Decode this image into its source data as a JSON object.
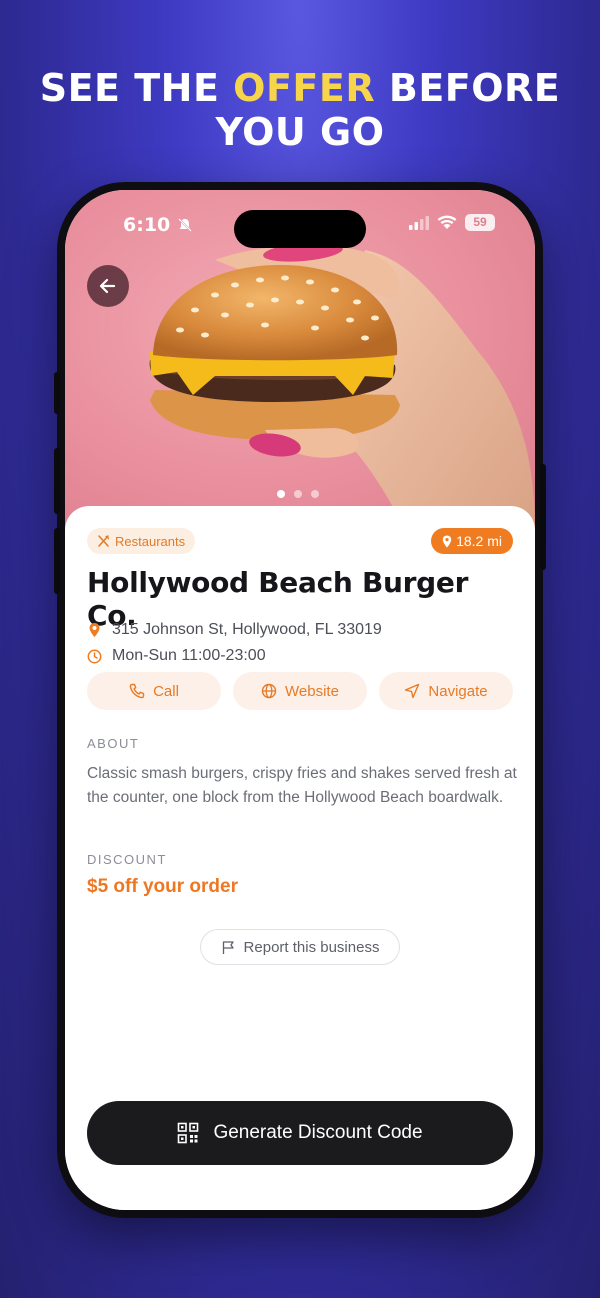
{
  "headline": {
    "part1": "SEE THE ",
    "highlight": "OFFER",
    "part2": " BEFORE",
    "line2": "YOU GO"
  },
  "status_bar": {
    "time": "6:10",
    "battery": "59"
  },
  "hero": {
    "image_description_icon": "burger-photo",
    "pager": {
      "count": 3,
      "active": 0
    }
  },
  "business": {
    "category": "Restaurants",
    "distance": "18.2 mi",
    "name": "Hollywood Beach Burger Co.",
    "address": "315 Johnson St, Hollywood, FL 33019",
    "hours": "Mon-Sun 11:00-23:00"
  },
  "actions": {
    "call": "Call",
    "website": "Website",
    "navigate": "Navigate"
  },
  "about": {
    "label": "ABOUT",
    "text": "Classic smash burgers, crispy fries and shakes served fresh at the counter, one block from the Hollywood Beach boardwalk."
  },
  "discount": {
    "label": "DISCOUNT",
    "text": "$5 off your order"
  },
  "report_label": "Report this business",
  "cta_label": "Generate Discount Code",
  "colors": {
    "accent": "#f07c22",
    "headline_highlight": "#f7d54b",
    "cta_background": "#1b1b1d"
  }
}
